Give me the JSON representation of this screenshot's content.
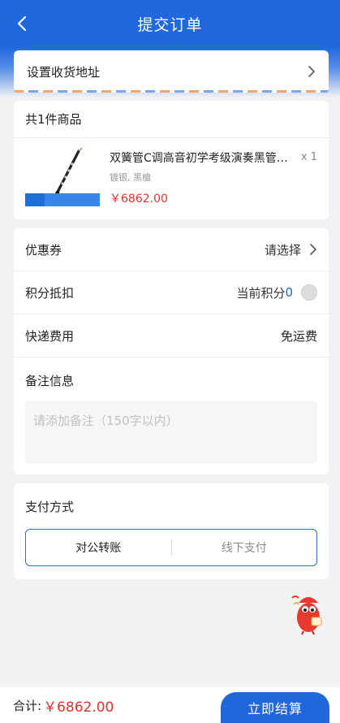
{
  "header": {
    "title": "提交订单",
    "back_icon": "chevron-left-icon"
  },
  "address": {
    "label": "设置收货地址"
  },
  "goods": {
    "count_label": "共1件商品",
    "item": {
      "title": "双簧管C调高音初学考级演奏黑管…",
      "spec": "镀银, 黑檀",
      "price": "￥6862.00",
      "qty": "x 1"
    }
  },
  "options": {
    "coupon": {
      "label": "优惠券",
      "value": "请选择"
    },
    "points": {
      "label": "积分抵扣",
      "prefix": "当前积分",
      "value": "0"
    },
    "shipping": {
      "label": "快递费用",
      "value": "免运费"
    },
    "remark": {
      "label": "备注信息",
      "placeholder": "请添加备注（150字以内）"
    }
  },
  "payment": {
    "label": "支付方式",
    "methods": [
      "对公转账",
      "线下支付"
    ],
    "selected": "对公转账"
  },
  "footer": {
    "total_label": "合计:",
    "total_value": "￥6862.00",
    "submit_label": "立即结算"
  },
  "colors": {
    "primary": "#1f68dd",
    "price": "#e4322b",
    "background": "#f2f2f4"
  }
}
